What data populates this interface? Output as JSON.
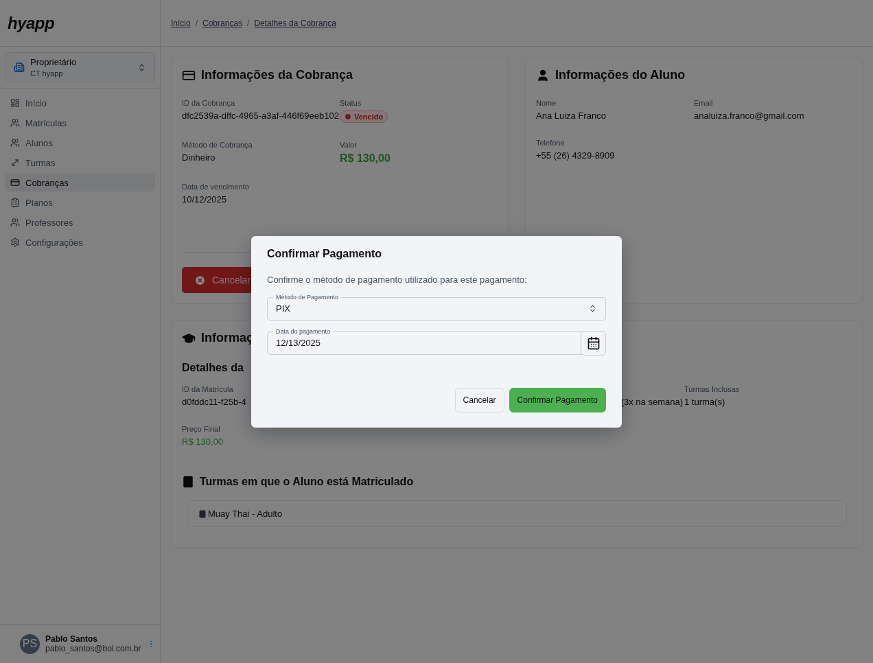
{
  "sidebar": {
    "logo": "hyapp",
    "account": {
      "role": "Proprietário",
      "org": "CT hyapp"
    },
    "items": [
      {
        "label": "Início",
        "selected": false
      },
      {
        "label": "Matrículas",
        "selected": false
      },
      {
        "label": "Alunos",
        "selected": false
      },
      {
        "label": "Turmas",
        "selected": false
      },
      {
        "label": "Cobranças",
        "selected": true
      },
      {
        "label": "Planos",
        "selected": false
      },
      {
        "label": "Professores",
        "selected": false
      },
      {
        "label": "Configurações",
        "selected": false
      }
    ],
    "user": {
      "initials": "PS",
      "name": "Pablo Santos",
      "email": "pablo_santos@bol.com.br"
    }
  },
  "breadcrumbs": {
    "items": [
      "Início",
      "Cobranças",
      "Detalhes da Cobrança"
    ],
    "separator": "/"
  },
  "charge_card": {
    "title": "Informações da Cobrança",
    "fields": [
      {
        "label": "ID da Cobrança",
        "value": "dfc2539a-dffc-4965-a3af-446f69eeb102",
        "kind": "text"
      },
      {
        "label": "Status",
        "value": "Vencido",
        "kind": "badge"
      },
      {
        "label": "Método de Cobrança",
        "value": "Dinheiro",
        "kind": "text"
      },
      {
        "label": "Valor",
        "value": "R$ 130,00",
        "kind": "amount"
      },
      {
        "label": "Data de vencimento",
        "value": "10/12/2025",
        "kind": "text"
      }
    ],
    "button": "Cancelar"
  },
  "student_card": {
    "title": "Informações do Aluno",
    "fields": [
      {
        "label": "Nome",
        "value": "Ana Luiza Franco"
      },
      {
        "label": "Email",
        "value": "analuiza.franco@gmail.com"
      },
      {
        "label": "Telefone",
        "value": "+55 (26) 4329-8909"
      }
    ]
  },
  "enrollment_card": {
    "title": "Informaç",
    "subtitle": "Detalhes da",
    "fields": [
      {
        "label": "ID da Matrícula",
        "value": "d0fddc11-f25b-4",
        "kind": "text"
      },
      {
        "value": "(3x na semana)",
        "kind": "partial"
      },
      {
        "label": "Turmas Inclusas",
        "value": "1 turma(s)",
        "kind": "text"
      },
      {
        "label": "Preço Final",
        "value": "R$ 130,00",
        "kind": "small_amount"
      }
    ],
    "classes_title": "Turmas em que o Aluno está Matriculado",
    "classes": [
      "Muay Thai - Adulto"
    ]
  },
  "dialog": {
    "title": "Confirmar Pagamento",
    "description": "Confirme o método de pagamento utilizado para este pagamento:",
    "method": {
      "label": "Método de Pagamento",
      "value": "PIX"
    },
    "date": {
      "label": "Data do pagamento",
      "value": "12/13/2025"
    },
    "buttons": [
      "Cancelar",
      "Confirmar Pagamento"
    ]
  }
}
